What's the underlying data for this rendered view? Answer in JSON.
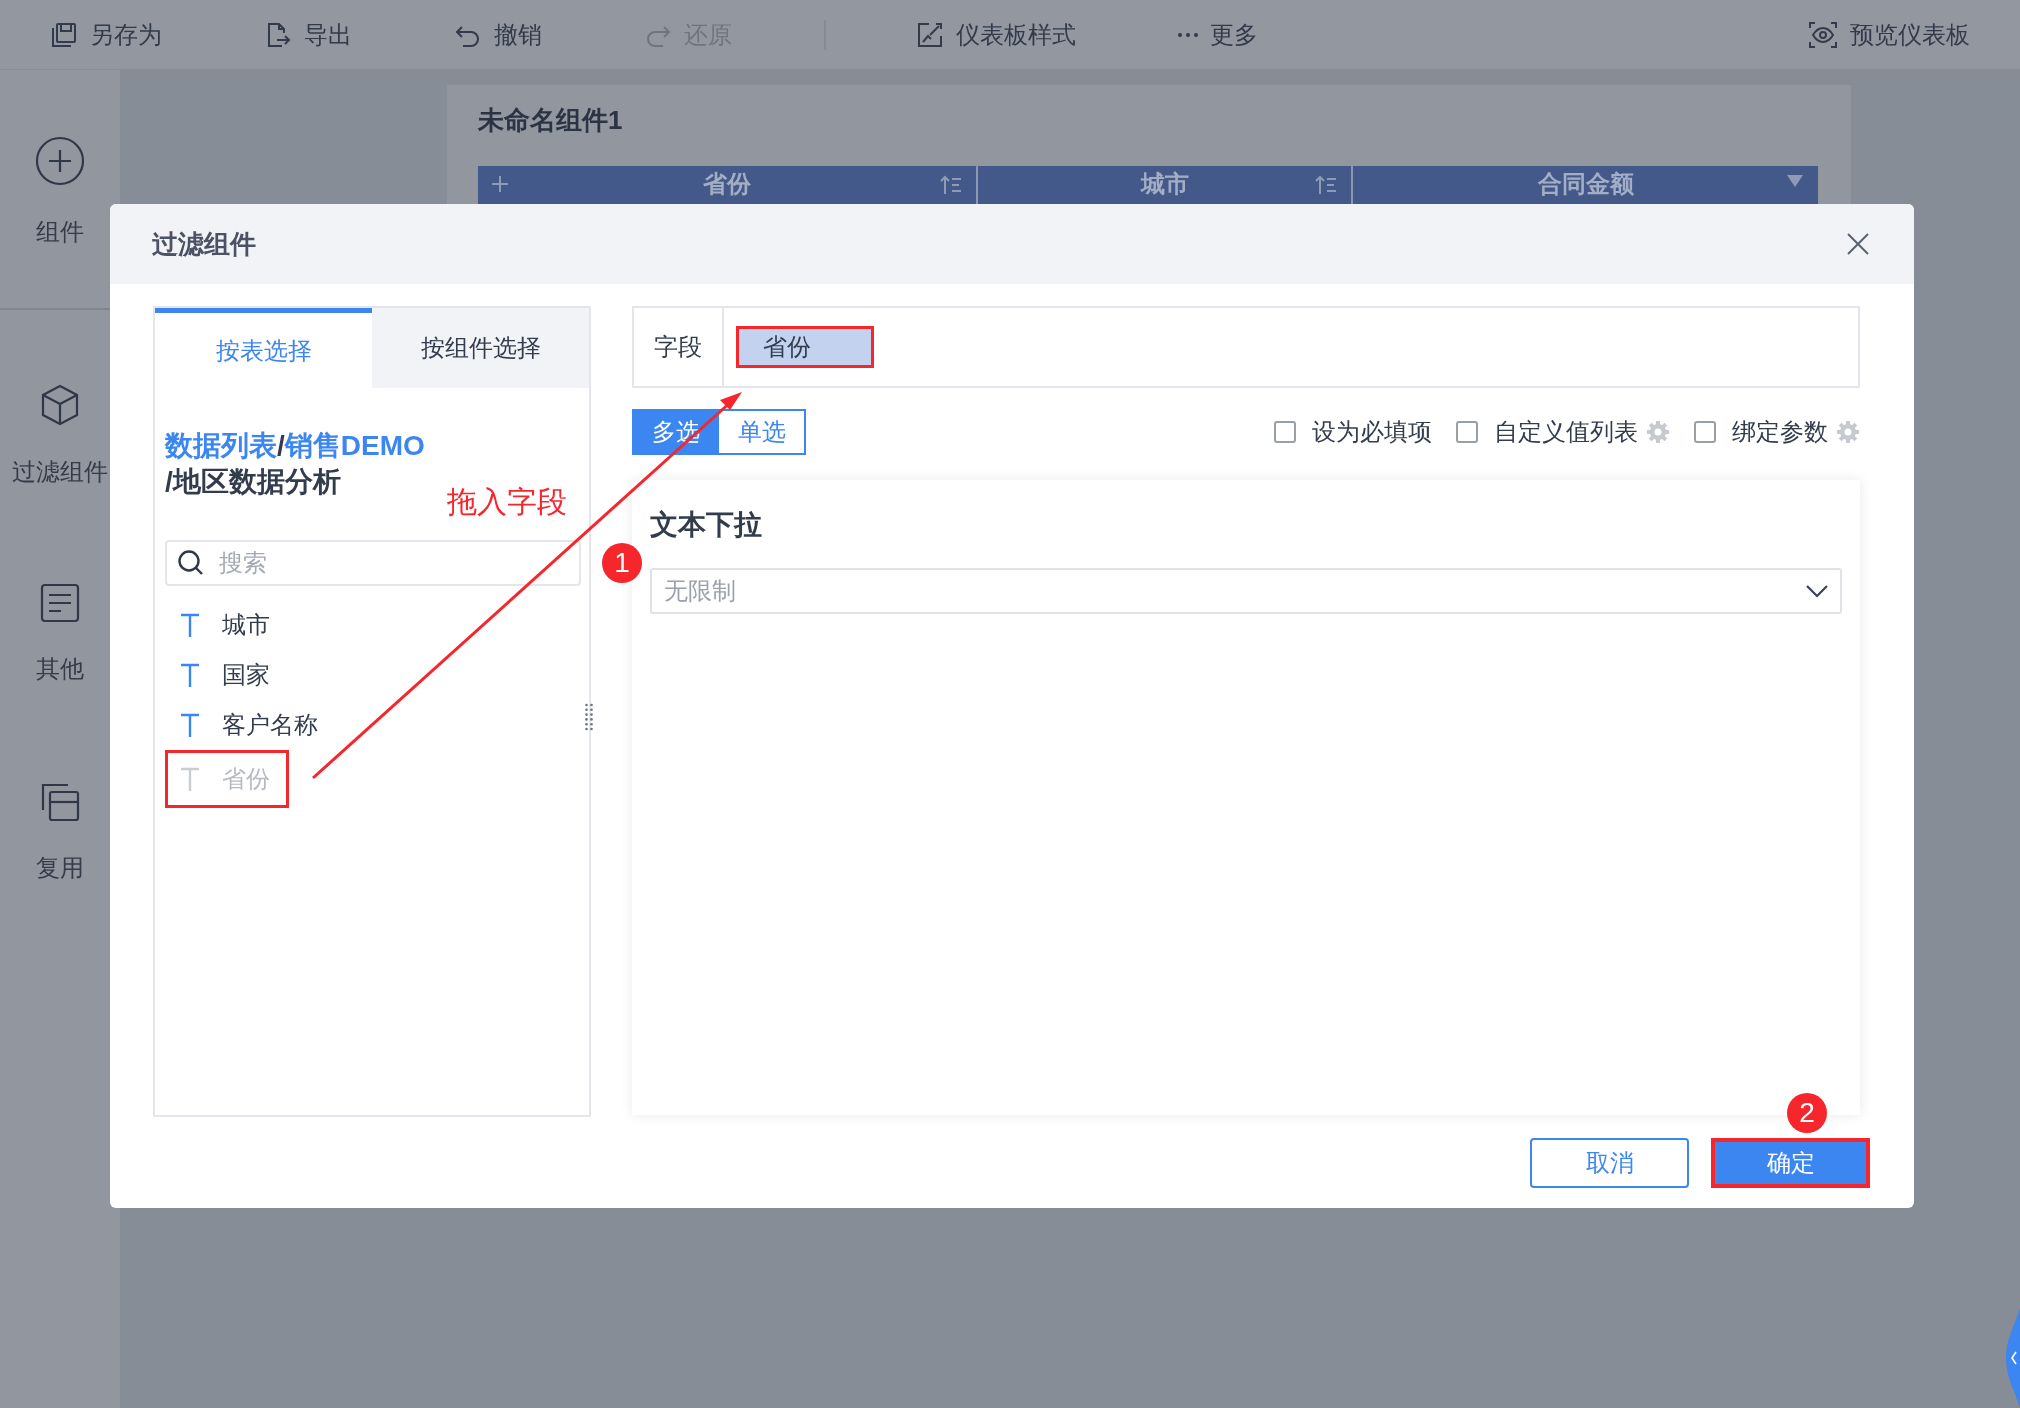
{
  "toolbar": {
    "edit_actions": [
      {
        "label": "另存为",
        "kind": "save",
        "disabled": false
      },
      {
        "label": "导出",
        "kind": "export",
        "disabled": false
      },
      {
        "label": "撤销",
        "kind": "undo",
        "disabled": false
      },
      {
        "label": "还原",
        "kind": "redo",
        "disabled": true
      }
    ],
    "view_actions": [
      {
        "label": "仪表板样式",
        "kind": "style",
        "disabled": false
      },
      {
        "label": "更多",
        "kind": "more",
        "disabled": false
      }
    ],
    "preview": {
      "label": "预览仪表板",
      "kind": "preview"
    }
  },
  "sidebar": [
    {
      "label": "组件",
      "kind": "add"
    },
    {
      "label": "过滤组件",
      "kind": "filter"
    },
    {
      "label": "其他",
      "kind": "other"
    },
    {
      "label": "复用",
      "kind": "reuse"
    }
  ],
  "canvas": {
    "widget_title": "未命名组件1",
    "columns": [
      {
        "label": "省份",
        "kind": "sort"
      },
      {
        "label": "城市",
        "kind": "sort"
      },
      {
        "label": "合同金额",
        "kind": "filter"
      }
    ]
  },
  "dialog": {
    "title": "过滤组件",
    "tabs": [
      {
        "label": "按表选择",
        "selected": true
      },
      {
        "label": "按组件选择",
        "selected": false
      }
    ],
    "path": [
      {
        "segments": [
          {
            "text": "数据列表",
            "link": true
          },
          {
            "text": "/",
            "link": false
          },
          {
            "text": "销售DEMO",
            "link": true
          }
        ]
      },
      {
        "segments": [
          {
            "text": "/地区数据分析",
            "link": false
          }
        ]
      }
    ],
    "search": {
      "placeholder": "搜索"
    },
    "fields": [
      {
        "label": "城市",
        "disabled": false,
        "highlighted": false
      },
      {
        "label": "国家",
        "disabled": false,
        "highlighted": false
      },
      {
        "label": "客户名称",
        "disabled": false,
        "highlighted": false
      },
      {
        "label": "省份",
        "disabled": true,
        "highlighted": true
      }
    ],
    "field_label": "字段",
    "chips": [
      {
        "label": "省份",
        "highlighted": true
      }
    ],
    "modes": [
      {
        "label": "多选",
        "selected": true
      },
      {
        "label": "单选",
        "selected": false
      }
    ],
    "options": [
      {
        "label": "设为必填项",
        "checked": false,
        "settings": false
      },
      {
        "label": "自定义值列表",
        "checked": false,
        "settings": true
      },
      {
        "label": "绑定参数",
        "checked": false,
        "settings": true
      }
    ],
    "widget": {
      "title": "文本下拉",
      "select": {
        "placeholder": "无限制"
      }
    },
    "buttons": [
      {
        "label": "取消",
        "kind": "secondary",
        "highlighted": false
      },
      {
        "label": "确定",
        "kind": "primary",
        "highlighted": true
      }
    ]
  },
  "annotations": {
    "drag_hint": "拖入字段",
    "steps": [
      "1",
      "2"
    ]
  }
}
